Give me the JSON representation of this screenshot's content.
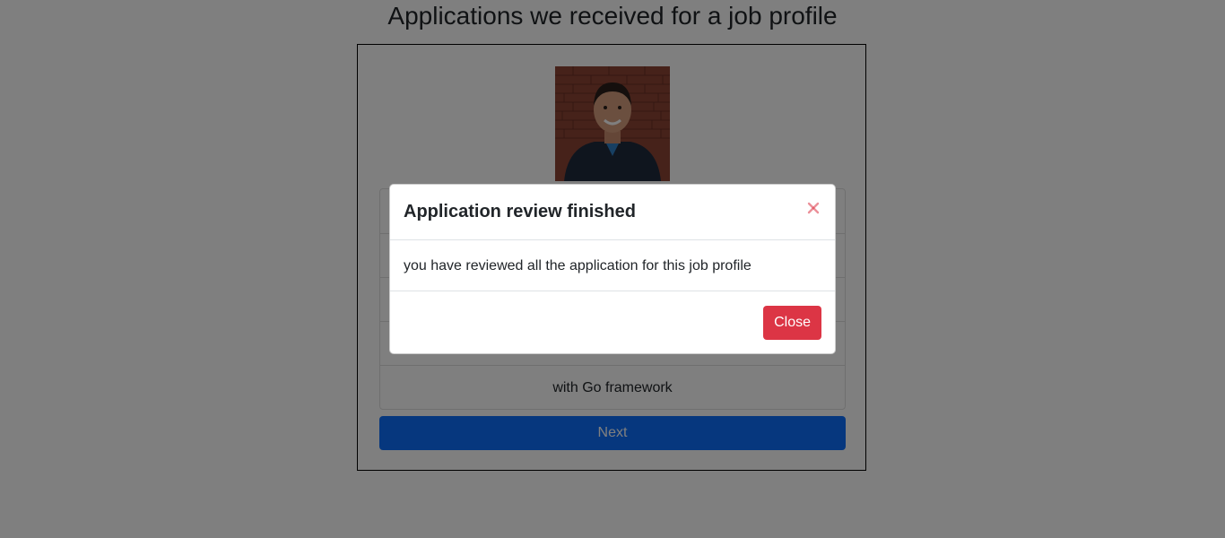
{
  "page": {
    "title": "Applications we received for a job profile"
  },
  "application": {
    "photo_alt": "applicant photo",
    "details": [
      "",
      "",
      "",
      "",
      "with Go framework"
    ],
    "next_label": "Next"
  },
  "modal": {
    "title": "Application review finished",
    "close_icon": "close-icon",
    "message": "you have reviewed all the application for this job profile",
    "close_label": "Close"
  },
  "colors": {
    "primary": "#0d6efd",
    "danger": "#dc3545",
    "backdrop": "#000000"
  }
}
